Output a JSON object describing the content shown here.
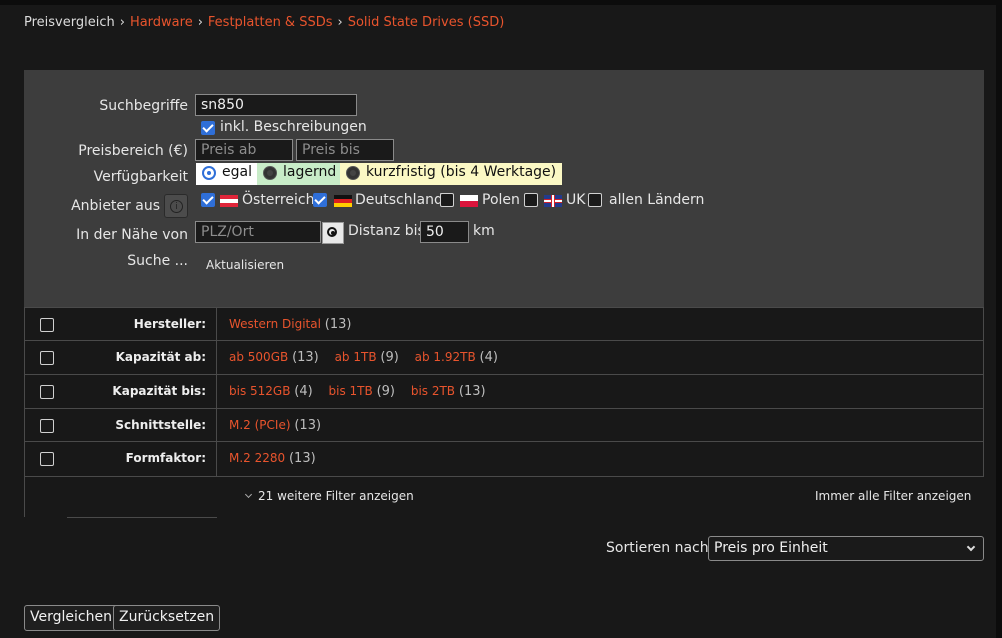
{
  "breadcrumb": {
    "root": "Preisvergleich",
    "items": [
      "Hardware",
      "Festplatten & SSDs",
      "Solid State Drives (SSD)"
    ],
    "separator": "›"
  },
  "search": {
    "label_term": "Suchbegriffe",
    "term_value": "sn850",
    "incl_desc_label": "inkl. Beschreibungen",
    "incl_desc_checked": true,
    "label_price": "Preisbereich (€)",
    "price_from_placeholder": "Preis ab",
    "price_to_placeholder": "Preis bis",
    "label_availability": "Verfügbarkeit",
    "availability": [
      "egal",
      "lagernd",
      "kurzfristig (bis 4 Werktage)"
    ],
    "availability_selected": "egal",
    "label_vendor": "Anbieter aus",
    "countries": [
      {
        "name": "Österreich",
        "checked": true,
        "flag": "flag-at"
      },
      {
        "name": "Deutschland",
        "checked": true,
        "flag": "flag-de"
      },
      {
        "name": "Polen",
        "checked": false,
        "flag": "flag-pl"
      },
      {
        "name": "UK",
        "checked": false,
        "flag": "flag-uk"
      },
      {
        "name": "allen Ländern",
        "checked": false,
        "flag": ""
      }
    ],
    "label_near": "In der Nähe von",
    "near_placeholder": "PLZ/Ort",
    "distance_label": "Distanz bis",
    "distance_value": "50",
    "distance_unit": "km",
    "label_search": "Suche ...",
    "refresh_label": "Aktualisieren"
  },
  "filters": [
    {
      "label": "Hersteller:",
      "options": [
        {
          "name": "Western Digital",
          "count": "(13)"
        }
      ]
    },
    {
      "label": "Kapazität ab:",
      "options": [
        {
          "name": "ab 500GB",
          "count": "(13)"
        },
        {
          "name": "ab 1TB",
          "count": "(9)"
        },
        {
          "name": "ab 1.92TB",
          "count": "(4)"
        }
      ]
    },
    {
      "label": "Kapazität bis:",
      "options": [
        {
          "name": "bis 512GB",
          "count": "(4)"
        },
        {
          "name": "bis 1TB",
          "count": "(9)"
        },
        {
          "name": "bis 2TB",
          "count": "(13)"
        }
      ]
    },
    {
      "label": "Schnittstelle:",
      "options": [
        {
          "name": "M.2 (PCIe)",
          "count": "(13)"
        }
      ]
    },
    {
      "label": "Formfaktor:",
      "options": [
        {
          "name": "M.2 2280",
          "count": "(13)"
        }
      ]
    }
  ],
  "more_filters_label": "21 weitere Filter anzeigen",
  "always_show_filters_label": "Immer alle Filter anzeigen",
  "sort": {
    "label": "Sortieren nach:",
    "selected": "Preis pro Einheit"
  },
  "buttons": {
    "compare": "Vergleichen",
    "reset": "Zurücksetzen"
  },
  "colors": {
    "accent_link": "#e8542d",
    "panel_bg": "#3d3d3d",
    "page_bg": "#181818",
    "checkbox_blue": "#2f6fd8"
  }
}
